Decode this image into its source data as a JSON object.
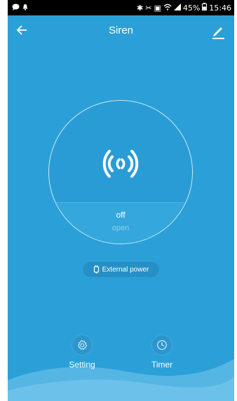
{
  "statusbar": {
    "battery_percent": "45%",
    "time": "15:46"
  },
  "header": {
    "title": "Siren"
  },
  "device": {
    "state": "off",
    "sub_state": "open"
  },
  "power_badge": {
    "label": "External power"
  },
  "actions": [
    {
      "label": "Setting",
      "icon": "gear-icon"
    },
    {
      "label": "Timer",
      "icon": "clock-icon"
    }
  ],
  "colors": {
    "background": "#2ba0d8",
    "accent": "#ffffff"
  }
}
